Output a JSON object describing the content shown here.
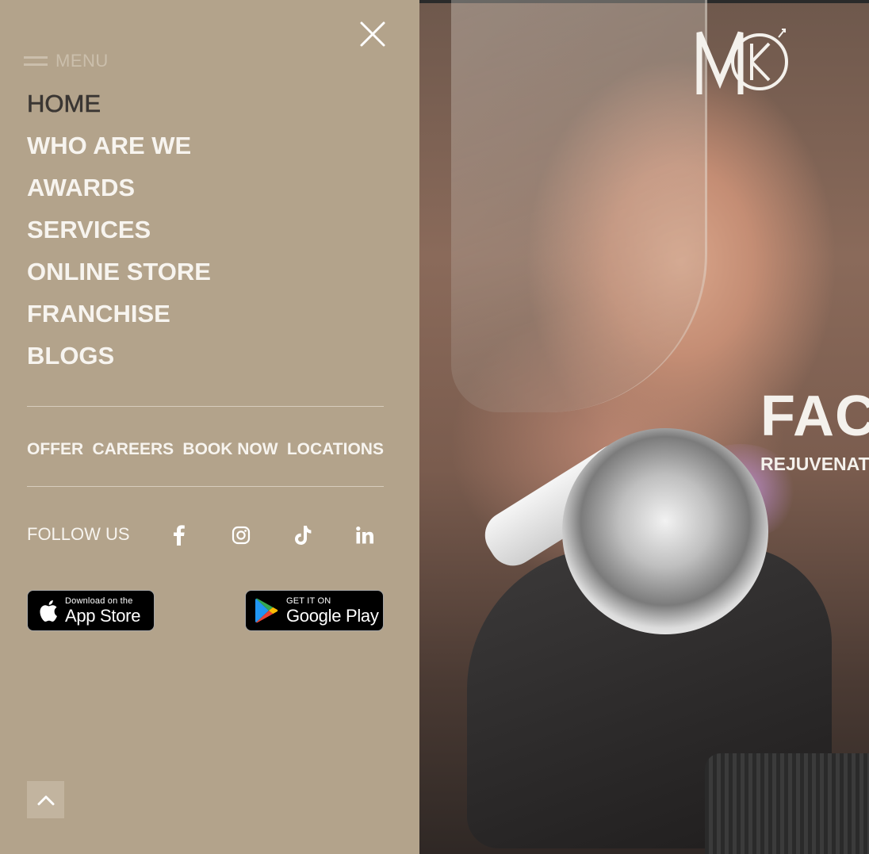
{
  "menu": {
    "label": "MENU",
    "nav_items": [
      {
        "label": "HOME",
        "active": true
      },
      {
        "label": "WHO ARE WE",
        "active": false
      },
      {
        "label": "AWARDS",
        "active": false
      },
      {
        "label": "SERVICES",
        "active": false
      },
      {
        "label": "ONLINE STORE",
        "active": false
      },
      {
        "label": "FRANCHISE",
        "active": false
      },
      {
        "label": "BLOGS",
        "active": false
      }
    ],
    "quick_links": [
      "OFFER",
      "CAREERS",
      "BOOK NOW",
      "LOCATIONS"
    ],
    "follow_label": "FOLLOW US",
    "social": [
      "facebook-icon",
      "instagram-icon",
      "tiktok-icon",
      "linkedin-icon"
    ],
    "app_store": {
      "small": "Download on the",
      "big": "App Store"
    },
    "google_play": {
      "small": "GET IT ON",
      "big": "Google Play"
    },
    "close_icon": "close-icon",
    "back_to_top_icon": "chevron-up-icon"
  },
  "hero": {
    "title": "FAC",
    "subtitle": "REJUVENATI",
    "logo_text": "MK"
  },
  "colors": {
    "panel_bg": "#b3a38b",
    "nav_text": "#f7f4ef",
    "nav_active": "#3a3633",
    "back_to_top_bg": "#c2b49f"
  }
}
